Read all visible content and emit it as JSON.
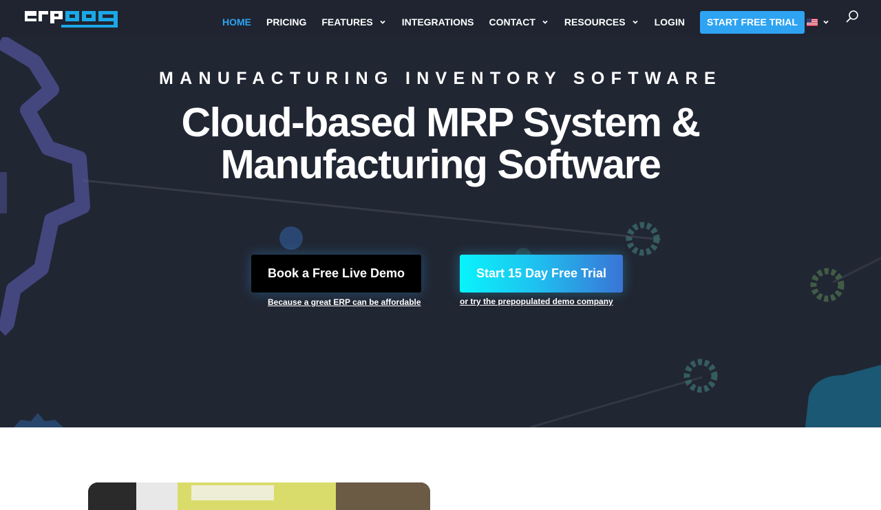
{
  "header": {
    "logo_text": "erpag",
    "nav": [
      {
        "label": "HOME",
        "active": true,
        "has_dropdown": false
      },
      {
        "label": "PRICING",
        "active": false,
        "has_dropdown": false
      },
      {
        "label": "FEATURES",
        "active": false,
        "has_dropdown": true
      },
      {
        "label": "INTEGRATIONS",
        "active": false,
        "has_dropdown": false
      },
      {
        "label": "CONTACT",
        "active": false,
        "has_dropdown": true
      },
      {
        "label": "RESOURCES",
        "active": false,
        "has_dropdown": true
      },
      {
        "label": "LOGIN",
        "active": false,
        "has_dropdown": false
      }
    ],
    "cta_label": "START FREE TRIAL",
    "language_icon": "us-flag-icon",
    "search_icon": "search-icon"
  },
  "hero": {
    "eyebrow": "MANUFACTURING INVENTORY SOFTWARE",
    "title_line1": "Cloud-based MRP System &",
    "title_line2": "Manufacturing Software",
    "demo_button": "Book a Free Live Demo",
    "demo_caption": "Because a great ERP can be affordable",
    "trial_button": "Start 15 Day Free Trial",
    "trial_caption": "or try the prepopulated demo company"
  },
  "colors": {
    "hero_background": "#212633",
    "accent": "#2ea3f2",
    "gradient_start": "#08f4fb",
    "gradient_end": "#3a74d6",
    "logo_blue": "#1ba8e6"
  }
}
